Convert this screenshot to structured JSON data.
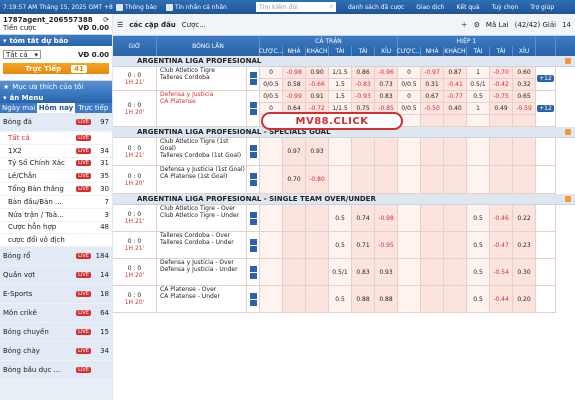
{
  "topbar": {
    "datetime": "7:19:57 AM Tháng 15, 2025 GMT +8",
    "announcement": "Thông báo",
    "inbox": "Tin nhắn cá nhân",
    "search_placeholder": "Tìm kiếm đội",
    "links": [
      "danh sách đã cược",
      "Giao dịch",
      "Kết quả",
      "Tuỳ chọn",
      "Trợ giúp"
    ]
  },
  "account": {
    "username": "1787agent_206557388",
    "balance_label": "Tiền cược",
    "balance": "VĐ 0.00"
  },
  "summary": {
    "header": "tóm tắt dự báo",
    "select_value": "Tất cả",
    "amount": "VĐ 0.00",
    "live_label": "Trực Tiếp",
    "live_count": "41",
    "favorites": "Mục ưa thích của tôi"
  },
  "menu": {
    "header": "ắn Menu",
    "tabs": [
      "Ngày mai",
      "Hôm nay",
      "Trực tiếp"
    ],
    "items": [
      {
        "name": "Bóng đá",
        "live": true,
        "count": "97",
        "kind": "main"
      },
      {
        "name": "Tất cả",
        "live": true,
        "count": "",
        "kind": "sub",
        "active": true
      },
      {
        "name": "1X2",
        "live": true,
        "count": "34",
        "kind": "sub"
      },
      {
        "name": "Tỷ Số Chính Xác",
        "live": true,
        "count": "31",
        "kind": "sub"
      },
      {
        "name": "Lẻ/Chẵn",
        "live": true,
        "count": "35",
        "kind": "sub"
      },
      {
        "name": "Tổng Bàn thắng",
        "live": true,
        "count": "30",
        "kind": "sub"
      },
      {
        "name": "Bàn đầu/Bàn ...",
        "live": false,
        "count": "7",
        "kind": "sub"
      },
      {
        "name": "Nửa trận / Toà...",
        "live": false,
        "count": "3",
        "kind": "sub"
      },
      {
        "name": "Cược hỗn hợp",
        "live": false,
        "count": "48",
        "kind": "sub"
      },
      {
        "name": "cược đổi vô địch",
        "live": false,
        "count": "",
        "kind": "sub"
      },
      {
        "name": "Bóng rổ",
        "live": true,
        "count": "184",
        "kind": "main"
      },
      {
        "name": "Quần vợt",
        "live": true,
        "count": "14",
        "kind": "main"
      },
      {
        "name": "E-Sports",
        "live": true,
        "count": "18",
        "kind": "main"
      },
      {
        "name": "Môn crikê",
        "live": true,
        "count": "64",
        "kind": "main"
      },
      {
        "name": "Bóng chuyền",
        "live": true,
        "count": "15",
        "kind": "main"
      },
      {
        "name": "Bóng chày",
        "live": true,
        "count": "34",
        "kind": "main"
      },
      {
        "name": "Bóng bầu dục ...",
        "live": true,
        "count": "",
        "kind": "main"
      }
    ]
  },
  "main": {
    "title": "các cặp đấu",
    "market": "Cược...",
    "sort": "Mã Lai",
    "leagues_count": "(42/42) Giải",
    "events_count": "14",
    "headers": {
      "time": "GIỜ",
      "event": "BÓNG LĂN",
      "full": "CẢ TRẬN",
      "half": "HIỆP 1",
      "sub": [
        "CƯỢC...",
        "NHÀ",
        "KHÁCH",
        "TÀI",
        "TÀI",
        "XỈU",
        "CƯỢC...",
        "NHÀ",
        "KHÁCH",
        "TÀI",
        "TÀI",
        "XỈU"
      ]
    },
    "watermark": "MV88.CLICK",
    "leagues": [
      {
        "name": "ARGENTINA LIGA PROFESIONAL",
        "matches": [
          {
            "score": "0 : 0",
            "time": "1H 21'",
            "home": "Club Atletico Tigre",
            "away": "Talleres Cordoba",
            "red": false,
            "lines": [
              [
                "0",
                "-0.98",
                "0.90",
                "1/1.5",
                "0.86",
                "-0.96",
                "0",
                "-0.97",
                "0.87",
                "1",
                "-0.70",
                "0.60"
              ],
              [
                "0/0.5",
                "0.58",
                "-0.66",
                "1.5",
                "-0.83",
                "0.73",
                "0/0.5",
                "0.31",
                "-0.41",
                "0.5/1",
                "-0.42",
                "0.32"
              ]
            ],
            "more": "12"
          },
          {
            "score": "0 : 0",
            "time": "1H 20'",
            "home": "Defensa y Justicia",
            "away": "CA Platense",
            "red": true,
            "lines": [
              [
                "0/0.5",
                "-0.99",
                "0.91",
                "1.5",
                "-0.93",
                "0.83",
                "0",
                "0.67",
                "-0.77",
                "0.5",
                "-0.75",
                "0.65"
              ],
              [
                "0",
                "0.64",
                "-0.72",
                "1/1.5",
                "0.75",
                "-0.85",
                "0/0.5",
                "-0.50",
                "0.40",
                "1",
                "0.49",
                "-0.59"
              ],
              [
                "0.5",
                "-0.64",
                "0.56",
                "1.5/2",
                "-0.65",
                "0.55",
                "",
                "",
                "",
                "",
                "",
                ""
              ]
            ],
            "more": "12"
          }
        ]
      },
      {
        "name": "ARGENTINA LIGA PROFESIONAL - SPECIALS GOAL",
        "matches": [
          {
            "score": "0 : 0",
            "time": "1H 21'",
            "home": "Club Atletico Tigre (1st Goal)",
            "away": "Talleres Cordoba (1st Goal)",
            "red": false,
            "lines": [
              [
                "",
                "0.97",
                "0.93",
                "",
                "",
                "",
                "",
                "",
                "",
                "",
                "",
                ""
              ]
            ],
            "more": ""
          },
          {
            "score": "0 : 0",
            "time": "1H 20'",
            "home": "Defensa y Justicia (1st Goal)",
            "away": "CA Platense (1st Goal)",
            "red": false,
            "lines": [
              [
                "",
                "0.70",
                "-0.80",
                "",
                "",
                "",
                "",
                "",
                "",
                "",
                "",
                ""
              ]
            ],
            "more": ""
          }
        ]
      },
      {
        "name": "ARGENTINA LIGA PROFESIONAL - SINGLE TEAM OVER/UNDER",
        "matches": [
          {
            "score": "0 : 0",
            "time": "1H 21'",
            "home": "Club Atletico Tigre - Over",
            "away": "Club Atletico Tigre - Under",
            "red": false,
            "lines": [
              [
                "",
                "",
                "",
                "0.5",
                "0.74",
                "-0.98",
                "",
                "",
                "",
                "0.5",
                "-0.46",
                "0.22"
              ]
            ],
            "more": ""
          },
          {
            "score": "0 : 0",
            "time": "1H 21'",
            "home": "Talleres Cordoba - Over",
            "away": "Talleres Cordoba - Under",
            "red": false,
            "lines": [
              [
                "",
                "",
                "",
                "0.5",
                "0.71",
                "-0.95",
                "",
                "",
                "",
                "0.5",
                "-0.47",
                "0.23"
              ]
            ],
            "more": ""
          },
          {
            "score": "0 : 0",
            "time": "1H 20'",
            "home": "Defensa y Justicia - Over",
            "away": "Defensa y Justicia - Under",
            "red": false,
            "lines": [
              [
                "",
                "",
                "",
                "0.5/1",
                "0.83",
                "0.93",
                "",
                "",
                "",
                "0.5",
                "-0.54",
                "0.30"
              ]
            ],
            "more": ""
          },
          {
            "score": "0 : 0",
            "time": "1H 20'",
            "home": "CA Platense - Over",
            "away": "CA Platense - Under",
            "red": false,
            "lines": [
              [
                "",
                "",
                "",
                "0.5",
                "0.88",
                "0.88",
                "",
                "",
                "",
                "0.5",
                "-0.44",
                "0.20"
              ]
            ],
            "more": ""
          }
        ]
      }
    ]
  }
}
